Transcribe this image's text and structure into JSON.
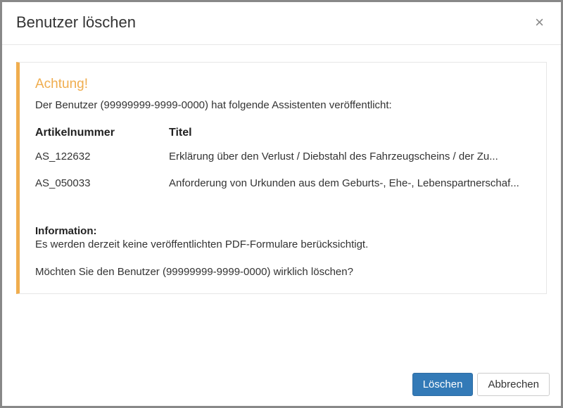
{
  "dialog": {
    "title": "Benutzer löschen",
    "close_label": "×"
  },
  "alert": {
    "title": "Achtung!",
    "intro": "Der Benutzer (99999999-9999-0000) hat folgende Assistenten veröffentlicht:",
    "table": {
      "header_article": "Artikelnummer",
      "header_title": "Titel",
      "rows": [
        {
          "article": "AS_122632",
          "title": "Erklärung über den Verlust / Diebstahl des Fahrzeugscheins / der Zu..."
        },
        {
          "article": "AS_050033",
          "title": "Anforderung von Urkunden aus dem Geburts-, Ehe-, Lebenspartnerschaf..."
        }
      ]
    },
    "info_heading": "Information:",
    "info_text": "Es werden derzeit keine veröffentlichten PDF-Formulare berücksichtigt.",
    "confirm_text": "Möchten Sie den Benutzer (99999999-9999-0000) wirklich löschen?"
  },
  "footer": {
    "delete_label": "Löschen",
    "cancel_label": "Abbrechen"
  }
}
